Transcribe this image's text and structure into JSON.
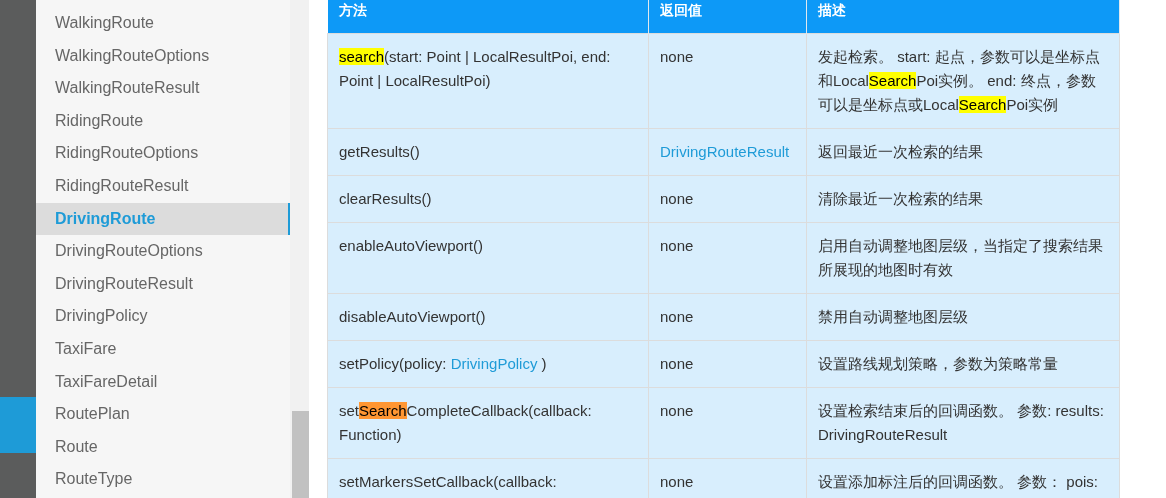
{
  "sidebar": {
    "items": [
      {
        "label": "WalkingRoute",
        "selected": false
      },
      {
        "label": "WalkingRouteOptions",
        "selected": false
      },
      {
        "label": "WalkingRouteResult",
        "selected": false
      },
      {
        "label": "RidingRoute",
        "selected": false
      },
      {
        "label": "RidingRouteOptions",
        "selected": false
      },
      {
        "label": "RidingRouteResult",
        "selected": false
      },
      {
        "label": "DrivingRoute",
        "selected": true
      },
      {
        "label": "DrivingRouteOptions",
        "selected": false
      },
      {
        "label": "DrivingRouteResult",
        "selected": false
      },
      {
        "label": "DrivingPolicy",
        "selected": false
      },
      {
        "label": "TaxiFare",
        "selected": false
      },
      {
        "label": "TaxiFareDetail",
        "selected": false
      },
      {
        "label": "RoutePlan",
        "selected": false
      },
      {
        "label": "Route",
        "selected": false
      },
      {
        "label": "RouteType",
        "selected": false
      }
    ]
  },
  "table": {
    "columns": [
      "方法",
      "返回值",
      "描述"
    ],
    "rows": [
      [
        [
          {
            "text": "search",
            "kind": "match"
          },
          {
            "text": "(start: Point | LocalResultPoi, end: Point | LocalResultPoi)",
            "kind": "plain"
          }
        ],
        [
          {
            "text": "none",
            "kind": "plain"
          }
        ],
        [
          {
            "text": "发起检索。 start: 起点，参数可以是坐标点和Local",
            "kind": "plain"
          },
          {
            "text": "Search",
            "kind": "match"
          },
          {
            "text": "Poi实例。 end: 终点，参数可以是坐标点或Local",
            "kind": "plain"
          },
          {
            "text": "Search",
            "kind": "match"
          },
          {
            "text": "Poi实例",
            "kind": "plain"
          }
        ]
      ],
      [
        [
          {
            "text": "getResults()",
            "kind": "plain"
          }
        ],
        [
          {
            "text": "DrivingRouteResult",
            "kind": "link"
          }
        ],
        [
          {
            "text": "返回最近一次检索的结果",
            "kind": "plain"
          }
        ]
      ],
      [
        [
          {
            "text": "clearResults()",
            "kind": "plain"
          }
        ],
        [
          {
            "text": "none",
            "kind": "plain"
          }
        ],
        [
          {
            "text": "清除最近一次检索的结果",
            "kind": "plain"
          }
        ]
      ],
      [
        [
          {
            "text": "enableAutoViewport()",
            "kind": "plain"
          }
        ],
        [
          {
            "text": "none",
            "kind": "plain"
          }
        ],
        [
          {
            "text": "启用自动调整地图层级，当指定了搜索结果所展现的地图时有效",
            "kind": "plain"
          }
        ]
      ],
      [
        [
          {
            "text": "disableAutoViewport()",
            "kind": "plain"
          }
        ],
        [
          {
            "text": "none",
            "kind": "plain"
          }
        ],
        [
          {
            "text": "禁用自动调整地图层级",
            "kind": "plain"
          }
        ]
      ],
      [
        [
          {
            "text": "setPolicy(policy: ",
            "kind": "plain"
          },
          {
            "text": "DrivingPolicy",
            "kind": "link"
          },
          {
            "text": " )",
            "kind": "plain"
          }
        ],
        [
          {
            "text": "none",
            "kind": "plain"
          }
        ],
        [
          {
            "text": "设置路线规划策略，参数为策略常量",
            "kind": "plain"
          }
        ]
      ],
      [
        [
          {
            "text": "set",
            "kind": "plain"
          },
          {
            "text": "Search",
            "kind": "current"
          },
          {
            "text": "CompleteCallback(callback: Function)",
            "kind": "plain"
          }
        ],
        [
          {
            "text": "none",
            "kind": "plain"
          }
        ],
        [
          {
            "text": "设置检索结束后的回调函数。 参数: results: DrivingRouteResult",
            "kind": "plain"
          }
        ]
      ],
      [
        [
          {
            "text": "setMarkersSetCallback(callback:",
            "kind": "plain"
          }
        ],
        [
          {
            "text": "none",
            "kind": "plain"
          }
        ],
        [
          {
            "text": "设置添加标注后的回调函数。 参数： pois:",
            "kind": "plain"
          }
        ]
      ]
    ]
  }
}
